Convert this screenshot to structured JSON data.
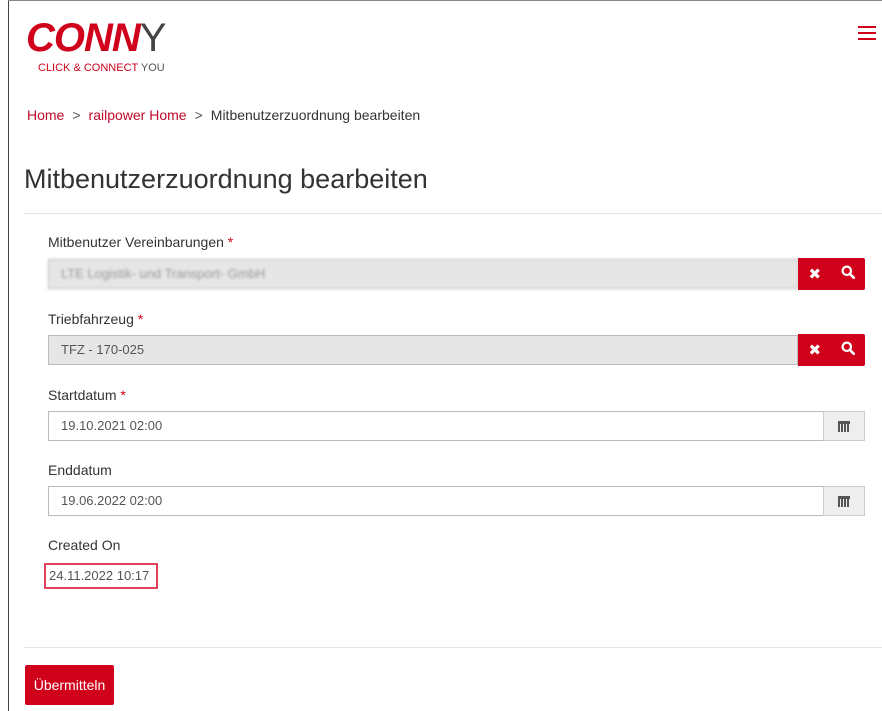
{
  "logo": {
    "part1": "CONN",
    "part2": "Y",
    "sub1": "CLICK & CONNECT",
    "sub2": " YOU"
  },
  "breadcrumb": {
    "home": "Home",
    "sep": ">",
    "parent": "railpower Home",
    "current": "Mitbenutzerzuordnung bearbeiten"
  },
  "page_title": "Mitbenutzerzuordnung bearbeiten",
  "fields": {
    "agreements": {
      "label": "Mitbenutzer Vereinbarungen",
      "required": "*",
      "value": "LTE Logistik- und Transport- GmbH"
    },
    "vehicle": {
      "label": "Triebfahrzeug",
      "required": "*",
      "value": "TFZ - 170-025"
    },
    "start": {
      "label": "Startdatum",
      "required": "*",
      "value": "19.10.2021 02:00"
    },
    "end": {
      "label": "Enddatum",
      "value": "19.06.2022 02:00"
    },
    "created": {
      "label": "Created On",
      "value": "24.11.2022 10:17"
    }
  },
  "icons": {
    "clear": "times-icon",
    "search": "search-icon",
    "calendar": "calendar-icon",
    "menu": "hamburger-icon"
  },
  "submit_label": "Übermitteln",
  "colors": {
    "accent": "#d0021b",
    "readonly_bg": "#e6e6e6",
    "highlight": "#e0415f"
  }
}
